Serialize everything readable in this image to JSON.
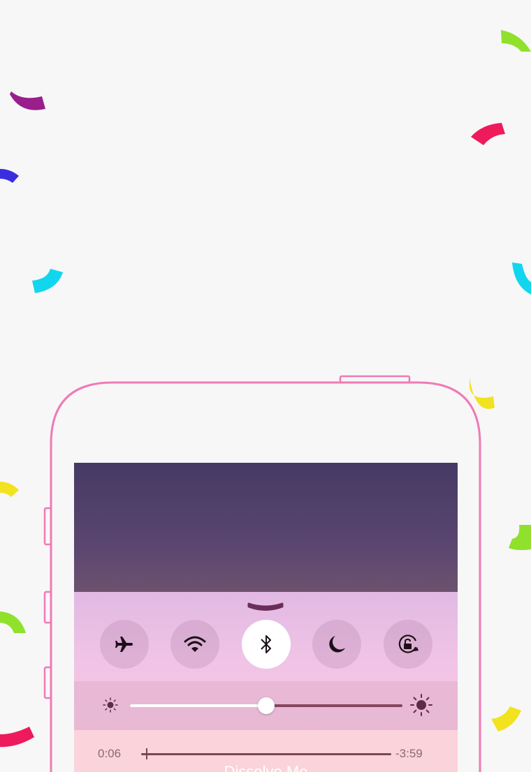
{
  "colors": {
    "background": "#f7f7f7",
    "phone_outline": "#f07ab6",
    "wallpaper_top": "#453a64",
    "panel_top": "#e1b9e3",
    "music_bg": "#fbd3da"
  },
  "control_center": {
    "toggles": [
      {
        "name": "airplane-mode",
        "icon": "airplane-icon",
        "on": false
      },
      {
        "name": "wifi",
        "icon": "wifi-icon",
        "on": false
      },
      {
        "name": "bluetooth",
        "icon": "bluetooth-icon",
        "on": true
      },
      {
        "name": "do-not-disturb",
        "icon": "moon-icon",
        "on": false
      },
      {
        "name": "rotation-lock",
        "icon": "rotation-lock-icon",
        "on": false
      }
    ],
    "brightness": {
      "level": 0.5,
      "min_icon": "sun-small-icon",
      "max_icon": "sun-large-icon"
    },
    "music": {
      "elapsed": "0:06",
      "remaining": "-3:59",
      "progress": 0.02,
      "song_title": "Dissolve Me"
    }
  }
}
